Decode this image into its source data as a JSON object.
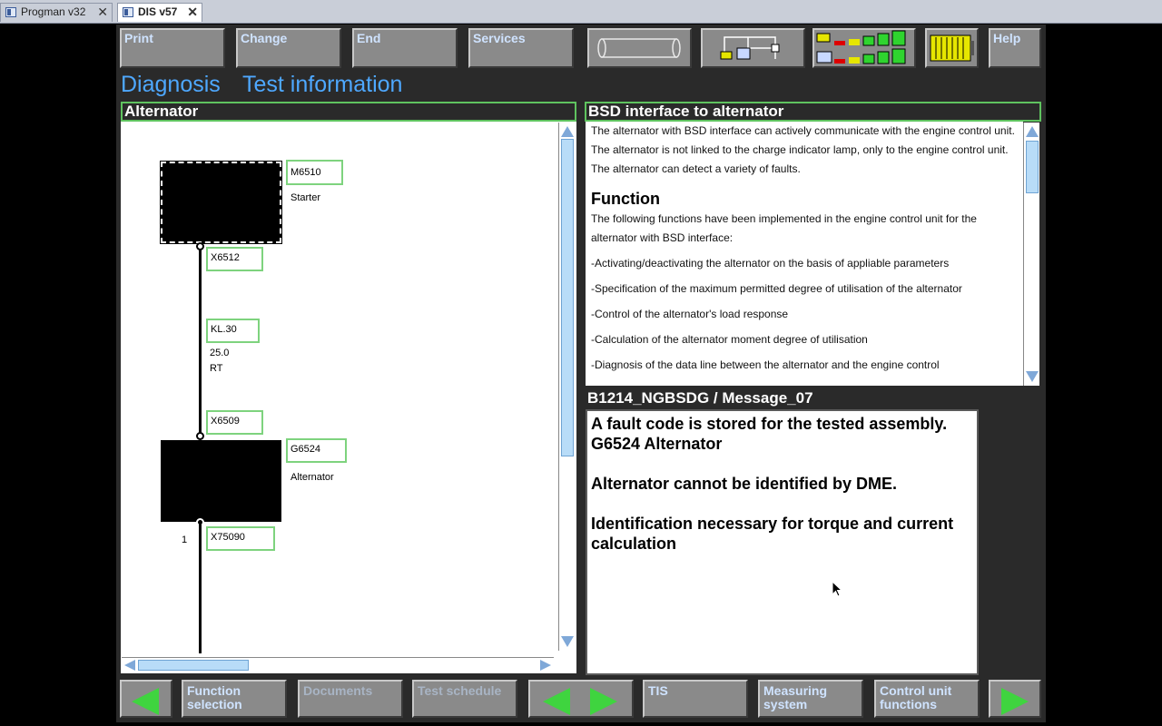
{
  "tabs": [
    {
      "label": "Progman v32"
    },
    {
      "label": "DIS v57"
    }
  ],
  "tab_close_glyph": "✕",
  "toolbar": {
    "print": "Print",
    "change": "Change",
    "end": "End",
    "services": "Services",
    "help": "Help",
    "icons": [
      "cylinder-icon",
      "network-icon",
      "signal-level-icon",
      "battery-icon"
    ]
  },
  "heading": {
    "diagnosis": "Diagnosis",
    "test_information": "Test information"
  },
  "left_panel": {
    "title": "Alternator",
    "components": {
      "m6510": "M6510",
      "starter": "Starter",
      "x6512": "X6512",
      "kl30": "KL.30",
      "wire_size": "25.0",
      "wire_color": "RT",
      "x6509": "X6509",
      "g6524": "G6524",
      "alternator": "Alternator",
      "pin": "1",
      "x75090": "X75090"
    }
  },
  "right_panel": {
    "title": "BSD interface to alternator",
    "intro": "The alternator with BSD interface can actively communicate with the engine control unit. The alternator is not linked to the charge indicator lamp, only to the engine control unit. The alternator can detect a variety of faults.",
    "function_heading": "Function",
    "function_intro": "The following functions have been implemented in the engine control unit for the alternator with BSD interface:",
    "bullets": [
      "-Activating/deactivating the alternator on the basis of appliable parameters",
      "-Specification of the maximum permitted degree of utilisation of the alternator",
      "-Control of the alternator's load response",
      "-Calculation of the alternator moment degree of utilisation",
      "-Diagnosis of the data line between the alternator and the engine control"
    ]
  },
  "message_panel": {
    "title": "B1214_NGBSDG / Message_07",
    "lines": [
      "A fault code is stored for the tested assembly.",
      "G6524 Alternator",
      "",
      "Alternator cannot be identified by DME.",
      "",
      "Identification necessary for torque and current calculation"
    ]
  },
  "bottom_bar": {
    "function_selection": "Function selection",
    "documents": "Documents",
    "test_schedule": "Test schedule",
    "tis": "TIS",
    "measuring_system": "Measuring system",
    "control_unit_functions": "Control unit functions"
  },
  "colors": {
    "accent_green": "#3fd43f",
    "heading_blue": "#4ea8ff",
    "label_border": "#7ed37e"
  }
}
